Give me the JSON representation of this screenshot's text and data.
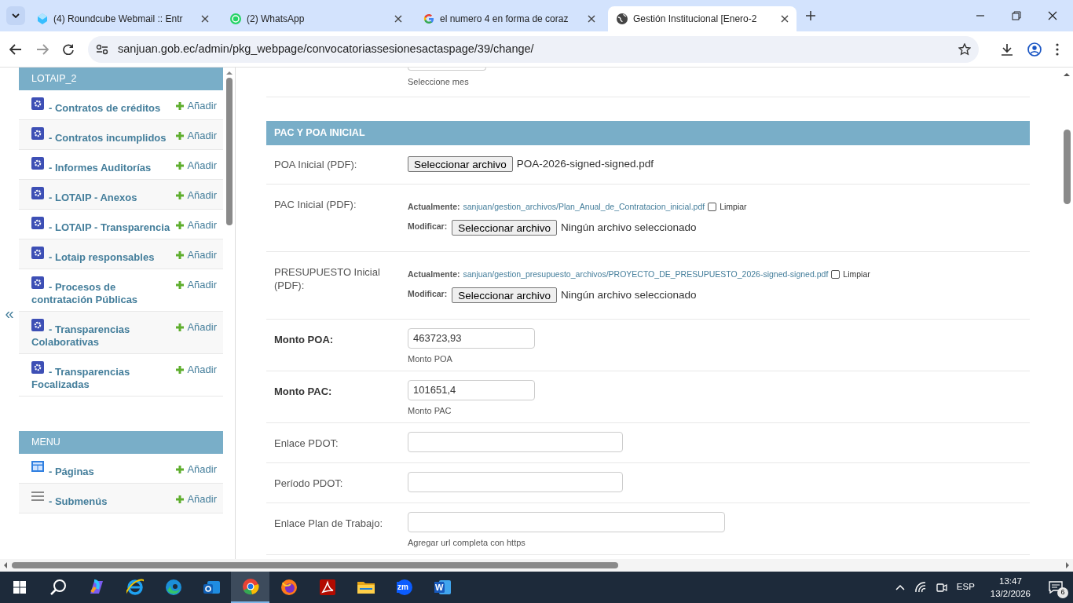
{
  "browser": {
    "tabs": [
      {
        "title": "(4) Roundcube Webmail :: Entr",
        "kind": "roundcube",
        "selected": false
      },
      {
        "title": "(2) WhatsApp",
        "kind": "whatsapp",
        "selected": false
      },
      {
        "title": "el numero 4 en forma de coraz",
        "kind": "google",
        "selected": false
      },
      {
        "title": "Gestión Institucional [Enero-2",
        "kind": "globe",
        "selected": true
      }
    ],
    "url": "sanjuan.gob.ec/admin/pkg_webpage/convocatoriassesionesactaspage/39/change/"
  },
  "sidebar": {
    "collapse": "«",
    "sections": [
      {
        "title": "LOTAIP_2",
        "items": [
          {
            "label": "- Contratos de créditos",
            "add": "Añadir",
            "kind": "gear"
          },
          {
            "label": "- Contratos incumplidos",
            "add": "Añadir",
            "kind": "gear"
          },
          {
            "label": "- Informes Auditorías",
            "add": "Añadir",
            "kind": "gear"
          },
          {
            "label": "- LOTAIP - Anexos",
            "add": "Añadir",
            "kind": "gear"
          },
          {
            "label": "- LOTAIP - Transparencia",
            "add": "Añadir",
            "kind": "gear"
          },
          {
            "label": "- Lotaip responsables",
            "add": "Añadir",
            "kind": "gear"
          },
          {
            "label": "- Procesos de contratación Públicas",
            "add": "Añadir",
            "kind": "gear"
          },
          {
            "label": "- Transparencias Colaborativas",
            "add": "Añadir",
            "kind": "gear"
          },
          {
            "label": "- Transparencias Focalizadas",
            "add": "Añadir",
            "kind": "gear"
          }
        ]
      },
      {
        "title": "MENU",
        "items": [
          {
            "label": "- Páginas",
            "add": "Añadir",
            "kind": "layout"
          },
          {
            "label": "- Submenús",
            "add": "Añadir",
            "kind": "lines"
          }
        ]
      }
    ]
  },
  "form": {
    "top_help": "Seleccione mes",
    "fieldset": "PAC Y POA INICIAL",
    "rows": [
      {
        "kind": "file",
        "label": "POA Inicial (PDF):",
        "button": "Seleccionar archivo",
        "filename": "POA-2026-signed-signed.pdf"
      },
      {
        "kind": "clearable_file",
        "label": "PAC Inicial (PDF):",
        "current_label": "Actualmente:",
        "current_link": "sanjuan/gestion_archivos/Plan_Anual_de_Contratacion_inicial.pdf",
        "clear_label": "Limpiar",
        "clear_checked": false,
        "change_label": "Modificar:",
        "button": "Seleccionar archivo",
        "filename": "Ningún archivo seleccionado"
      },
      {
        "kind": "clearable_file",
        "label": "PRESUPUESTO Inicial (PDF):",
        "current_label": "Actualmente:",
        "current_link": "sanjuan/gestion_presupuesto_archivos/PROYECTO_DE_PRESUPUESTO_2026-signed-signed.pdf",
        "clear_label": "Limpiar",
        "clear_checked": false,
        "change_label": "Modificar:",
        "button": "Seleccionar archivo",
        "filename": "Ningún archivo seleccionado"
      },
      {
        "kind": "number",
        "label": "Monto POA:",
        "required": true,
        "value": "463723,93",
        "help": "Monto POA"
      },
      {
        "kind": "number",
        "label": "Monto PAC:",
        "required": true,
        "value": "101651,4",
        "help": "Monto PAC"
      },
      {
        "kind": "text",
        "label": "Enlace PDOT:",
        "required": false
      },
      {
        "kind": "text",
        "label": "Período PDOT:",
        "required": false
      },
      {
        "kind": "url",
        "label": "Enlace Plan de Trabajo:",
        "required": false,
        "help": "Agregar url completa con https"
      }
    ]
  },
  "taskbar": {
    "apps": [
      {
        "kind": "start",
        "selected": false
      },
      {
        "kind": "search",
        "selected": false
      },
      {
        "kind": "copilot",
        "selected": false
      },
      {
        "kind": "ie",
        "selected": false
      },
      {
        "kind": "edge",
        "selected": false
      },
      {
        "kind": "outlook",
        "selected": false
      },
      {
        "kind": "chrome",
        "selected": true
      },
      {
        "kind": "firefox",
        "selected": false
      },
      {
        "kind": "acrobat",
        "selected": false
      },
      {
        "kind": "explorer",
        "selected": false
      },
      {
        "kind": "zoom",
        "selected": false,
        "label": "zm"
      },
      {
        "kind": "word",
        "selected": false,
        "label": "W"
      }
    ],
    "language": "ESP",
    "time": "13:47",
    "date": "13/2/2026",
    "notifications": "6"
  }
}
